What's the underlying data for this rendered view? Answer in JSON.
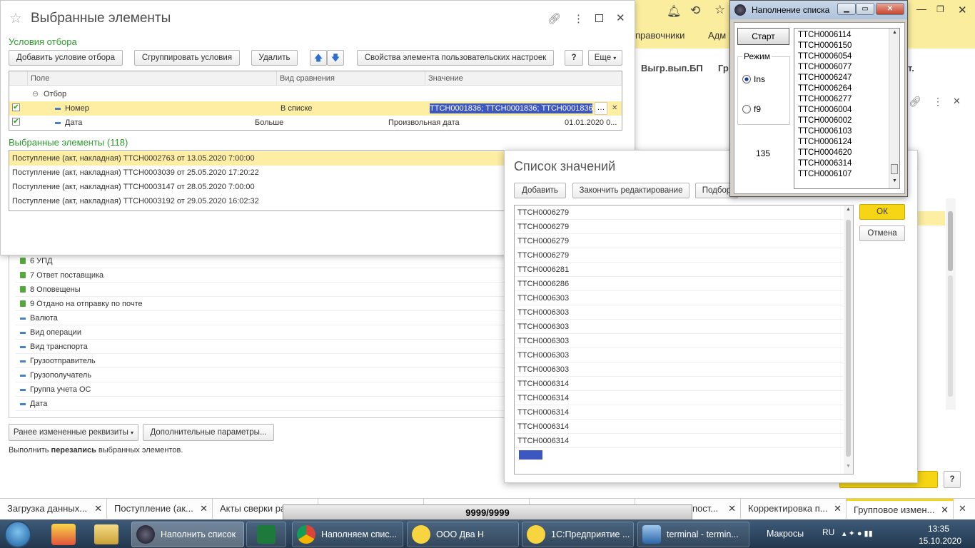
{
  "app": {
    "sections": [
      "правочники",
      "Адм"
    ],
    "toolbar_items": [
      "Выгр.вып.БП",
      "Гр"
    ],
    "toolbar_item_hidden": "т."
  },
  "back_list": {
    "items": [
      {
        "label": "6 УПД",
        "icon": "green-doc-icon"
      },
      {
        "label": "7 Ответ поставщика",
        "icon": "green-doc-icon"
      },
      {
        "label": "8 Оповещены",
        "icon": "green-doc-icon"
      },
      {
        "label": "9 Отдано на отправку по почте",
        "icon": "green-doc-icon"
      },
      {
        "label": "Валюта",
        "icon": "dash-icon"
      },
      {
        "label": "Вид операции",
        "icon": "dash-icon"
      },
      {
        "label": "Вид транспорта",
        "icon": "dash-icon"
      },
      {
        "label": "Грузоотправитель",
        "icon": "dash-icon"
      },
      {
        "label": "Грузополучатель",
        "icon": "dash-icon"
      },
      {
        "label": "Группа учета ОС",
        "icon": "dash-icon"
      },
      {
        "label": "Дата",
        "icon": "dash-icon"
      }
    ],
    "changed_props_btn": "Ранее измененные реквизиты",
    "extra_params_btn": "Дополнительные параметры...",
    "footer_text_pre": "Выполнить ",
    "footer_text_bold": "перезапись",
    "footer_text_post": " выбранных элементов.",
    "help_btn": "?"
  },
  "selected_dialog": {
    "title": "Выбранные элементы",
    "filter_section": "Условия отбора",
    "buttons": {
      "add_condition": "Добавить условие отбора",
      "group_conditions": "Сгруппировать условия",
      "delete": "Удалить",
      "properties": "Свойства элемента пользовательских настроек",
      "help": "?",
      "more": "Еще"
    },
    "columns": {
      "field": "Поле",
      "comparison": "Вид сравнения",
      "value": "Значение"
    },
    "group_row": "Отбор",
    "filters": [
      {
        "field": "Номер",
        "comparison": "В списке",
        "value": "ТТСН0001836; ТТСН0001836; ТТСН0001836; Т",
        "checked": true
      },
      {
        "field": "Дата",
        "comparison": "Больше",
        "extra": "Произвольная дата",
        "value": "01.01.2020 0...",
        "checked": true
      }
    ],
    "selected_header": "Выбранные элементы (118)",
    "selected_items": [
      "Поступление (акт, накладная) ТТСН0002763 от 13.05.2020 7:00:00",
      "Поступление (акт, накладная) ТТСН0003039 от 25.05.2020 17:20:22",
      "Поступление (акт, накладная) ТТСН0003147 от 28.05.2020 7:00:00",
      "Поступление (акт, накладная) ТТСН0003192 от 29.05.2020 16:02:32"
    ]
  },
  "values_dialog": {
    "title": "Список значений",
    "buttons": {
      "add": "Добавить",
      "finish": "Закончить редактирование",
      "pick": "Подбор",
      "ok": "ОК",
      "cancel": "Отмена"
    },
    "values": [
      "ТТСН0006279",
      "ТТСН0006279",
      "ТТСН0006279",
      "ТТСН0006279",
      "ТТСН0006281",
      "ТТСН0006286",
      "ТТСН0006303",
      "ТТСН0006303",
      "ТТСН0006303",
      "ТТСН0006303",
      "ТТСН0006303",
      "ТТСН0006303",
      "ТТСН0006314",
      "ТТСН0006314",
      "ТТСН0006314",
      "ТТСН0006314",
      "ТТСН0006314"
    ]
  },
  "fill_dialog": {
    "title": "Наполнение списка",
    "start_btn": "Старт",
    "mode_label": "Режим",
    "modes": [
      {
        "label": "Ins",
        "selected": true
      },
      {
        "label": "f9",
        "selected": false
      }
    ],
    "counter": "135",
    "list": [
      "ТТСН0006114",
      "ТТСН0006150",
      "ТТСН0006054",
      "ТТСН0006077",
      "ТТСН0006247",
      "ТТСН0006264",
      "ТТСН0006277",
      "ТТСН0006004",
      "ТТСН0006002",
      "ТТСН0006103",
      "ТТСН0006124",
      "ТТСН0004620",
      "ТТСН0006314",
      "ТТСН0006107"
    ]
  },
  "bottom_tabs": [
    "Загрузка данных...",
    "Поступление (ак...",
    "Акты сверки ра",
    "",
    "",
    "",
    "пост...",
    "Корректировка п...",
    "Групповое измен..."
  ],
  "progress": {
    "text": "9999/9999"
  },
  "taskbar": {
    "items": [
      {
        "label": "Наполнить список",
        "icon": "app-icon"
      },
      {
        "label": "",
        "icon": "excel-icon"
      },
      {
        "label": "Наполняем спис...",
        "icon": "chrome-icon"
      },
      {
        "label": "ООО Два Н",
        "icon": "1c-icon"
      },
      {
        "label": "1С:Предприятие ...",
        "icon": "1c-icon"
      },
      {
        "label": "terminal - termin...",
        "icon": "terminal-icon"
      }
    ],
    "macros": "Макросы",
    "lang": "RU",
    "time": "13:35",
    "date": "15.10.2020"
  },
  "colors": {
    "accent_green": "#2b9c2b",
    "highlight_yellow": "#fdeea3",
    "selection_blue": "#3d57c0",
    "ok_yellow": "#f5d514"
  }
}
